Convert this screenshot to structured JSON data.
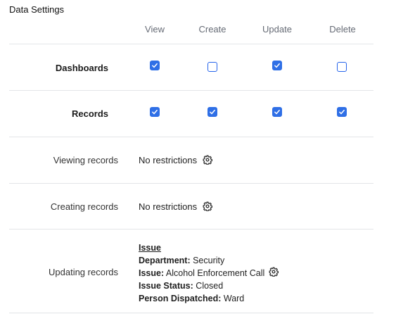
{
  "section_title": "Data Settings",
  "columns": [
    "View",
    "Create",
    "Update",
    "Delete"
  ],
  "permission_rows": [
    {
      "label": "Dashboards",
      "checks": [
        true,
        false,
        true,
        false
      ]
    },
    {
      "label": "Records",
      "checks": [
        true,
        true,
        true,
        true
      ]
    }
  ],
  "restriction_rows": [
    {
      "label": "Viewing records",
      "value": "No restrictions"
    },
    {
      "label": "Creating records",
      "value": "No restrictions"
    }
  ],
  "updating": {
    "label": "Updating records",
    "heading": "Issue",
    "conditions": [
      {
        "key": "Department:",
        "value": " Security"
      },
      {
        "key": "Issue:",
        "value": " Alcohol Enforcement Call"
      },
      {
        "key": "Issue Status:",
        "value": " Closed"
      },
      {
        "key": "Person Dispatched:",
        "value": " Ward"
      }
    ]
  },
  "icons": {
    "checkbox_checked": "checkbox-checked-icon",
    "checkbox_unchecked": "checkbox-unchecked-icon",
    "settings": "gear-icon"
  },
  "colors": {
    "accent": "#2f6fe6",
    "header_text": "#666b75",
    "divider": "#e3e5e8"
  }
}
